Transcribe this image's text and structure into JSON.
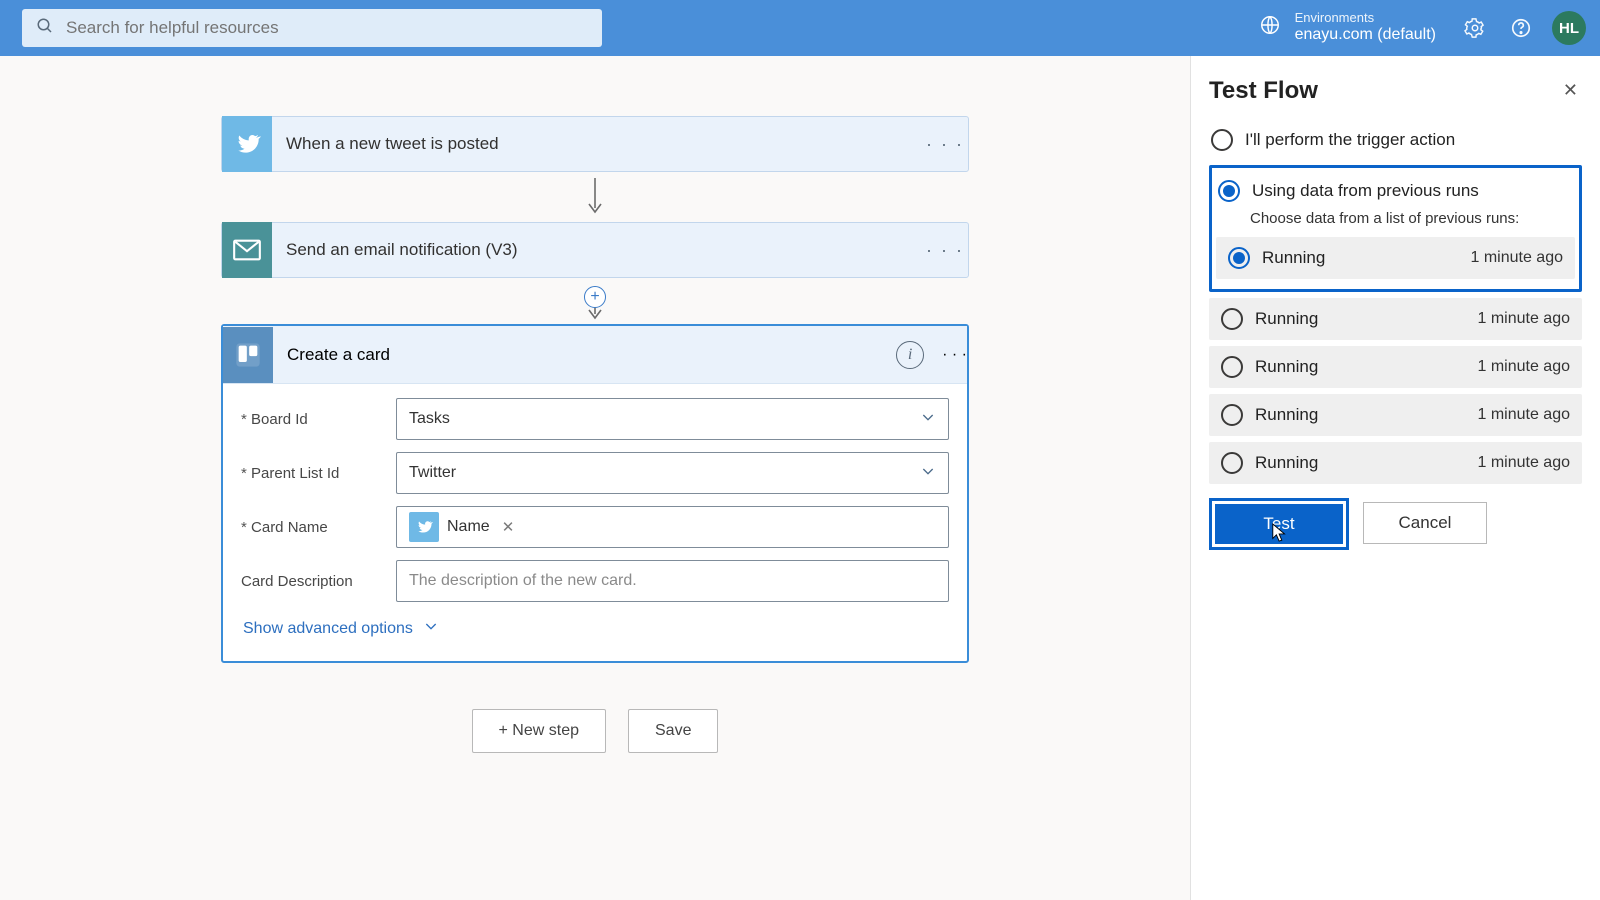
{
  "header": {
    "search_placeholder": "Search for helpful resources",
    "env_label": "Environments",
    "env_name": "enayu.com (default)",
    "avatar": "HL"
  },
  "flow": {
    "step1": {
      "title": "When a new tweet is posted"
    },
    "step2": {
      "title": "Send an email notification (V3)"
    },
    "card": {
      "title": "Create a card",
      "fields": {
        "board": {
          "label": "Board Id",
          "value": "Tasks"
        },
        "parent": {
          "label": "Parent List Id",
          "value": "Twitter"
        },
        "name": {
          "label": "Card Name",
          "token": "Name"
        },
        "desc": {
          "label": "Card Description",
          "placeholder": "The description of the new card."
        }
      },
      "advanced": "Show advanced options"
    },
    "new_step": "+ New step",
    "save": "Save"
  },
  "panel": {
    "title": "Test Flow",
    "opt_manual": "I'll perform the trigger action",
    "opt_prev": "Using data from previous runs",
    "opt_prev_sub": "Choose data from a list of previous runs:",
    "runs": [
      {
        "status": "Running",
        "time": "1 minute ago"
      },
      {
        "status": "Running",
        "time": "1 minute ago"
      },
      {
        "status": "Running",
        "time": "1 minute ago"
      },
      {
        "status": "Running",
        "time": "1 minute ago"
      },
      {
        "status": "Running",
        "time": "1 minute ago"
      }
    ],
    "test": "Test",
    "cancel": "Cancel"
  }
}
